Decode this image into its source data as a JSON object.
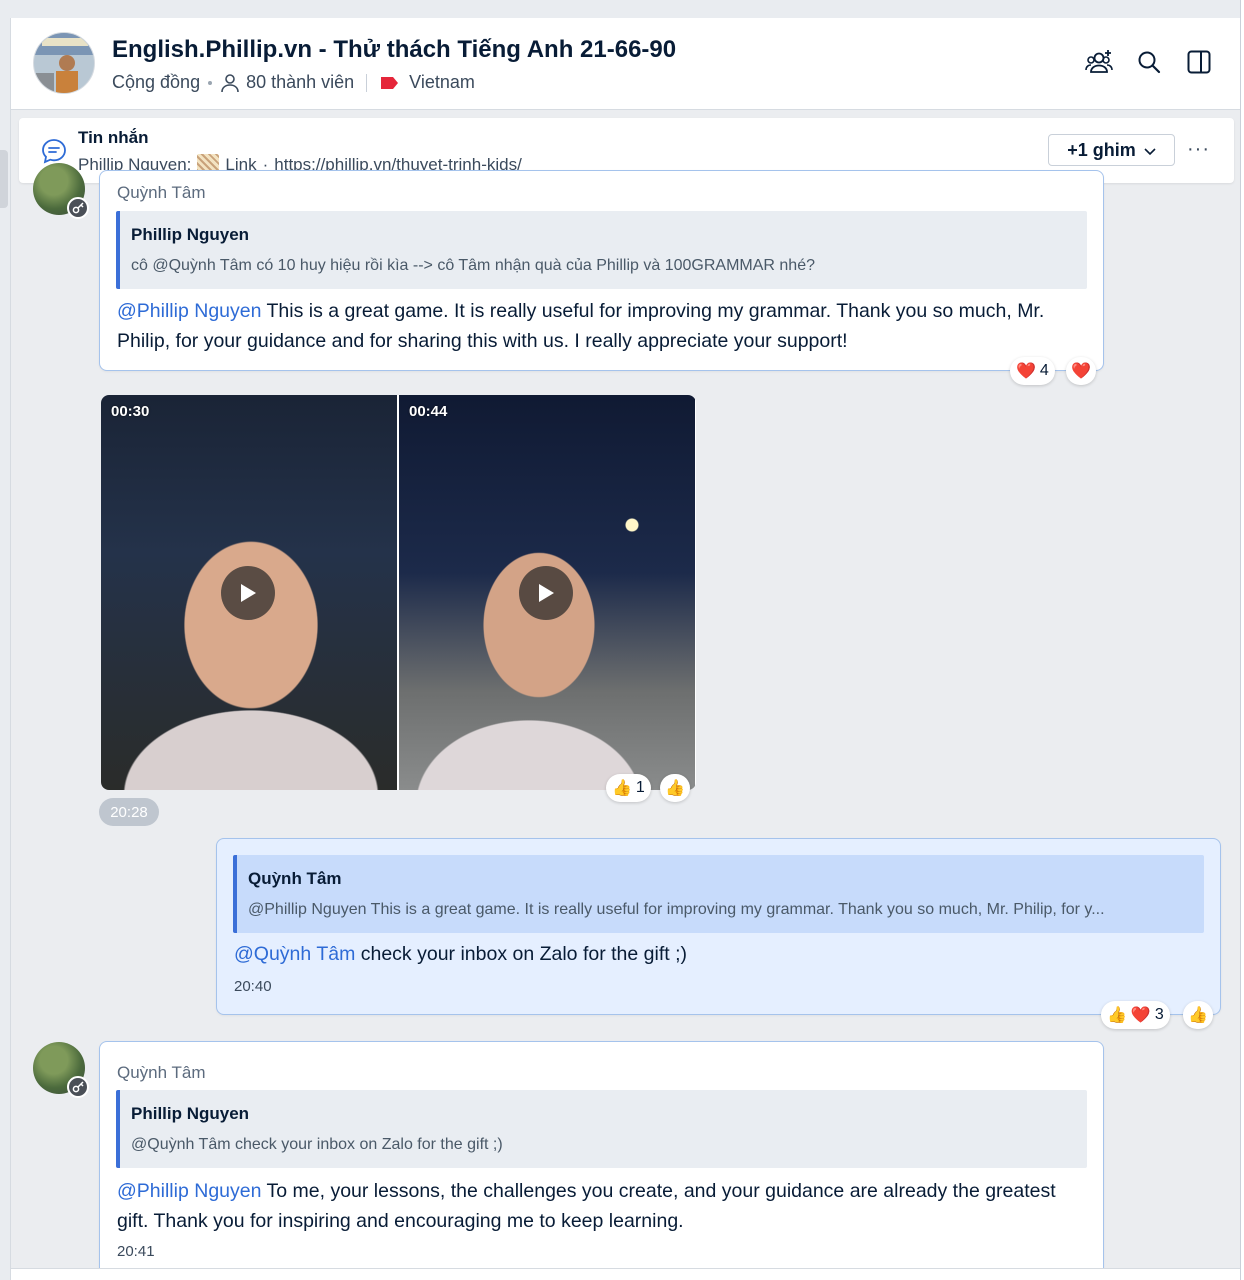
{
  "header": {
    "title": "English.Phillip.vn - Thử thách Tiếng Anh 21-66-90",
    "type": "Cộng đồng",
    "members": "80 thành viên",
    "label": "Vietnam",
    "label_color": "#e5263a",
    "icons": [
      "add-member-icon",
      "search-icon",
      "sidebar-toggle-icon"
    ]
  },
  "pinned": {
    "title": "Tin nhắn",
    "sender": "Phillip Nguyen:",
    "link_label": "Link",
    "separator": "·",
    "url": "https://phillip.vn/thuyet-trinh-kids/",
    "pins_button": "+1 ghim",
    "more": "···"
  },
  "messages": [
    {
      "sender": "Quỳnh Tâm",
      "quote_name": "Phillip Nguyen",
      "quote_text": "cô @Quỳnh Tâm có 10 huy hiệu rồi kìa --> cô Tâm nhận quà của Phillip và 100GRAMMAR nhé?",
      "mention": "@Phillip Nguyen",
      "text": " This is a great game. It is really useful for improving my grammar. Thank you so much, Mr. Philip, for your guidance and for sharing this with us. I really appreciate your support!",
      "reaction_count": "4"
    },
    {
      "videos": [
        {
          "duration": "00:30"
        },
        {
          "duration": "00:44"
        }
      ],
      "time": "20:28",
      "reaction_count": "1"
    },
    {
      "quote_name": "Quỳnh Tâm",
      "quote_text": "@Phillip Nguyen This is a great game. It is really useful for improving my grammar. Thank you so much, Mr. Philip, for y...",
      "mention": "@Quỳnh Tâm",
      "text": " check your inbox on Zalo for the gift ;)",
      "time": "20:40",
      "reaction_count": "3"
    },
    {
      "sender": "Quỳnh Tâm",
      "quote_name": "Phillip Nguyen",
      "quote_text": "@Quỳnh Tâm check your inbox on Zalo for the gift ;)",
      "mention": "@Phillip Nguyen",
      "text": " To me, your lessons, the challenges you create, and your guidance are already the greatest gift. Thank you for inspiring and encouraging me to keep learning.",
      "time": "20:41"
    }
  ],
  "colors": {
    "accent": "#2e6bd6",
    "bubble_border": "#a5c3ec",
    "mine_bubble": "#e5efff"
  }
}
